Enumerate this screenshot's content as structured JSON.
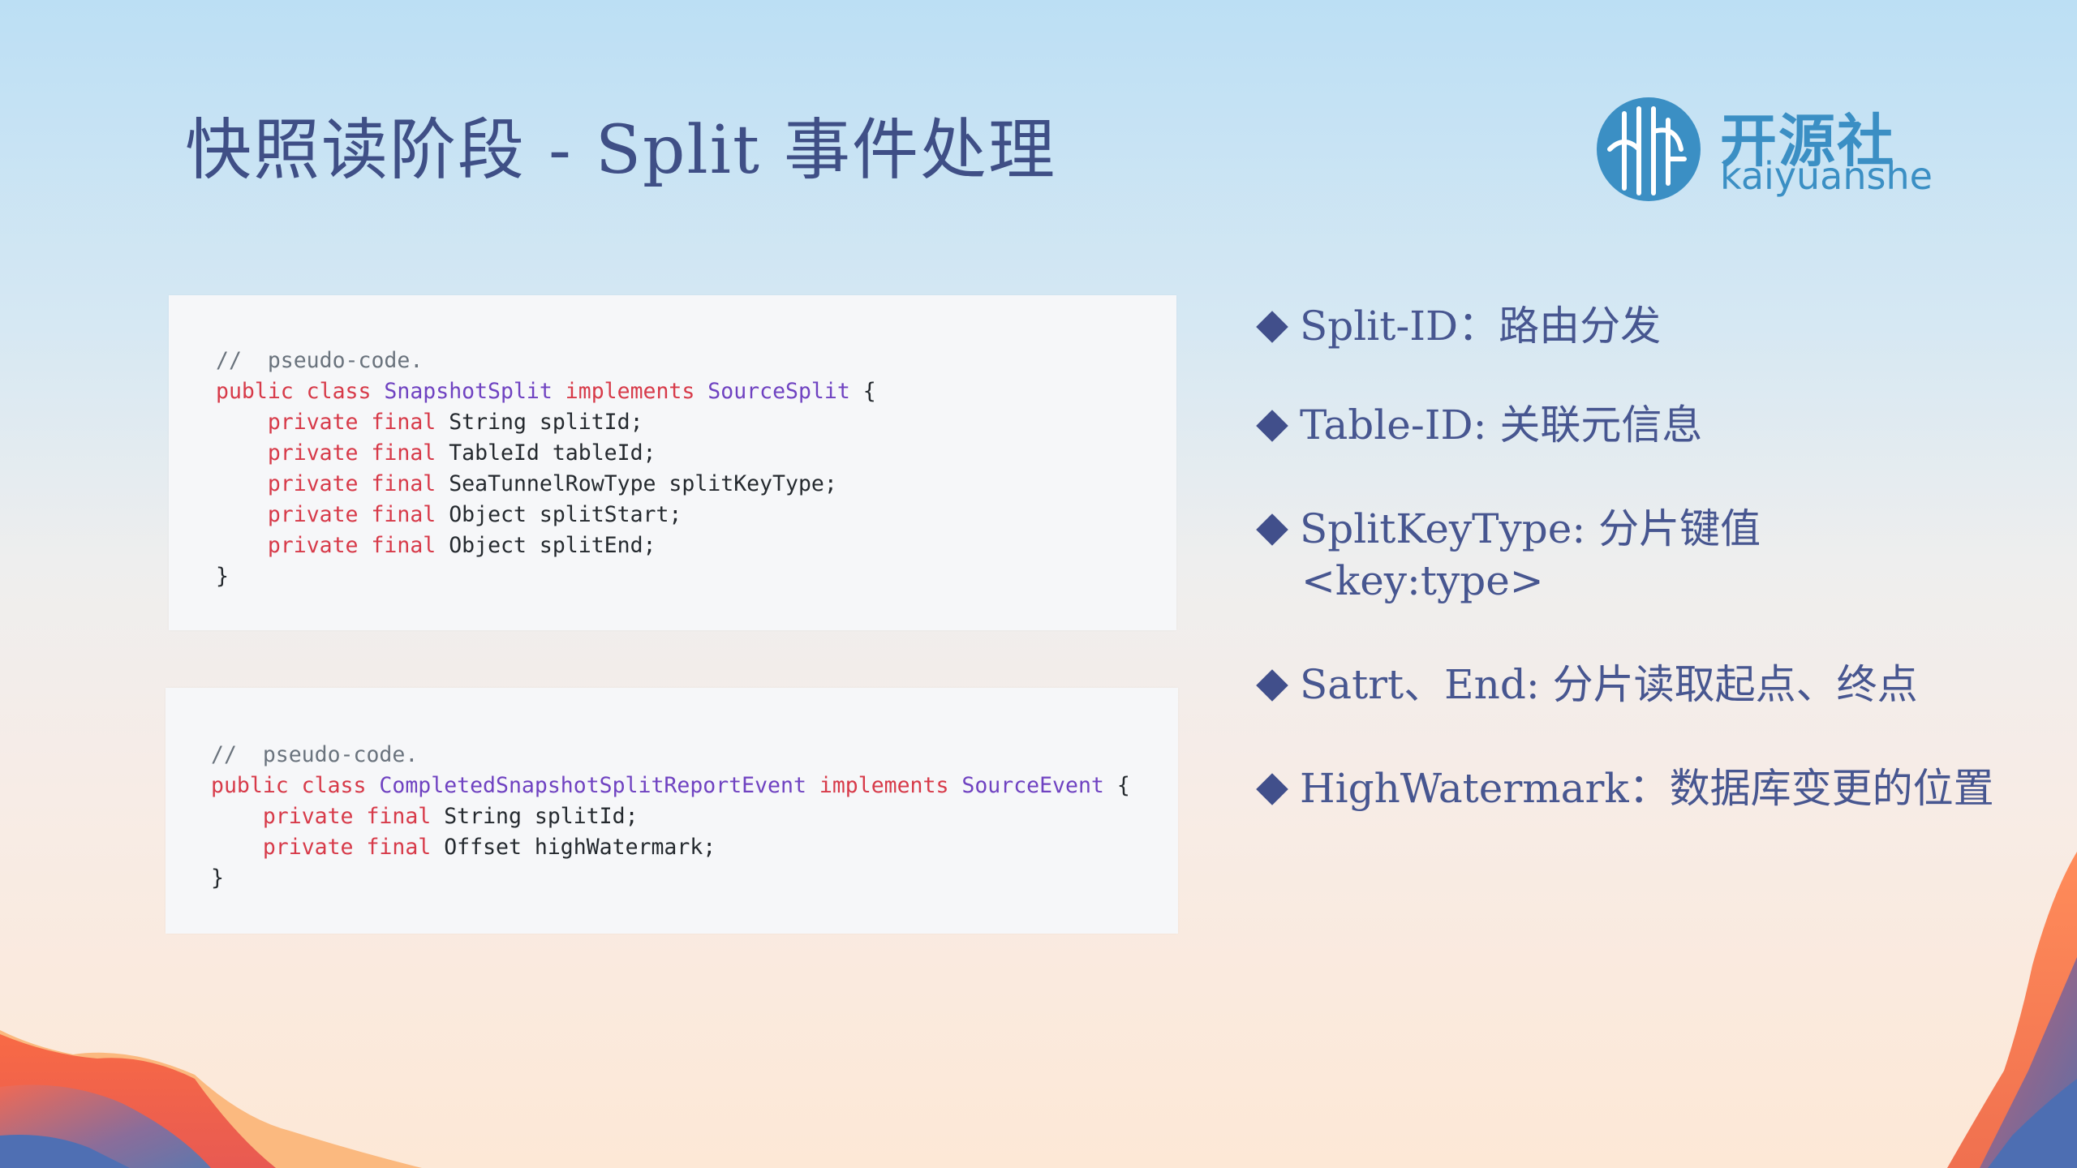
{
  "title": "快照读阶段 - Split 事件处理",
  "logo": {
    "name_cn": "开源社",
    "name_en": "kaiyuanshe",
    "color": "#3b8fc4"
  },
  "code_blocks": [
    {
      "lines": [
        {
          "tokens": [
            {
              "t": "//  pseudo-code.",
              "c": "cmt"
            }
          ]
        },
        {
          "tokens": [
            {
              "t": "public class ",
              "c": "kw"
            },
            {
              "t": "SnapshotSplit",
              "c": "cls"
            },
            {
              "t": " implements ",
              "c": "kw"
            },
            {
              "t": "SourceSplit",
              "c": "cls"
            },
            {
              "t": " {",
              "c": ""
            }
          ]
        },
        {
          "tokens": [
            {
              "t": "    ",
              "c": ""
            },
            {
              "t": "private final ",
              "c": "kw"
            },
            {
              "t": "String splitId;",
              "c": ""
            }
          ]
        },
        {
          "tokens": [
            {
              "t": "    ",
              "c": ""
            },
            {
              "t": "private final ",
              "c": "kw"
            },
            {
              "t": "TableId tableId;",
              "c": ""
            }
          ]
        },
        {
          "tokens": [
            {
              "t": "    ",
              "c": ""
            },
            {
              "t": "private final ",
              "c": "kw"
            },
            {
              "t": "SeaTunnelRowType splitKeyType;",
              "c": ""
            }
          ]
        },
        {
          "tokens": [
            {
              "t": "    ",
              "c": ""
            },
            {
              "t": "private final ",
              "c": "kw"
            },
            {
              "t": "Object splitStart;",
              "c": ""
            }
          ]
        },
        {
          "tokens": [
            {
              "t": "    ",
              "c": ""
            },
            {
              "t": "private final ",
              "c": "kw"
            },
            {
              "t": "Object splitEnd;",
              "c": ""
            }
          ]
        },
        {
          "tokens": [
            {
              "t": "}",
              "c": ""
            }
          ]
        }
      ]
    },
    {
      "lines": [
        {
          "tokens": [
            {
              "t": "//  pseudo-code.",
              "c": "cmt"
            }
          ]
        },
        {
          "tokens": [
            {
              "t": "public class ",
              "c": "kw"
            },
            {
              "t": "CompletedSnapshotSplitReportEvent",
              "c": "cls"
            },
            {
              "t": " implements ",
              "c": "kw"
            },
            {
              "t": "SourceEvent",
              "c": "cls"
            },
            {
              "t": " {",
              "c": ""
            }
          ]
        },
        {
          "tokens": [
            {
              "t": "    ",
              "c": ""
            },
            {
              "t": "private final ",
              "c": "kw"
            },
            {
              "t": "String splitId;",
              "c": ""
            }
          ]
        },
        {
          "tokens": [
            {
              "t": "    ",
              "c": ""
            },
            {
              "t": "private final ",
              "c": "kw"
            },
            {
              "t": "Offset highWatermark;",
              "c": ""
            }
          ]
        },
        {
          "tokens": [
            {
              "t": "}",
              "c": ""
            }
          ]
        }
      ]
    }
  ],
  "bullets": [
    {
      "text": "Split-ID：路由分发"
    },
    {
      "text": "Table-ID: 关联元信息"
    },
    {
      "text": "SplitKeyType:  分片键值",
      "text2": "<key:type>"
    },
    {
      "text": "Satrt、End:  分片读取起点、终点"
    },
    {
      "text": "HighWatermark：数据库变更的位置"
    }
  ],
  "colors": {
    "title": "#3f4f86",
    "bullet_text": "#475690",
    "bullet_marker": "#414f8b",
    "code_keyword": "#d73a49",
    "code_class": "#6f42c1",
    "code_comment": "#6a737d"
  }
}
